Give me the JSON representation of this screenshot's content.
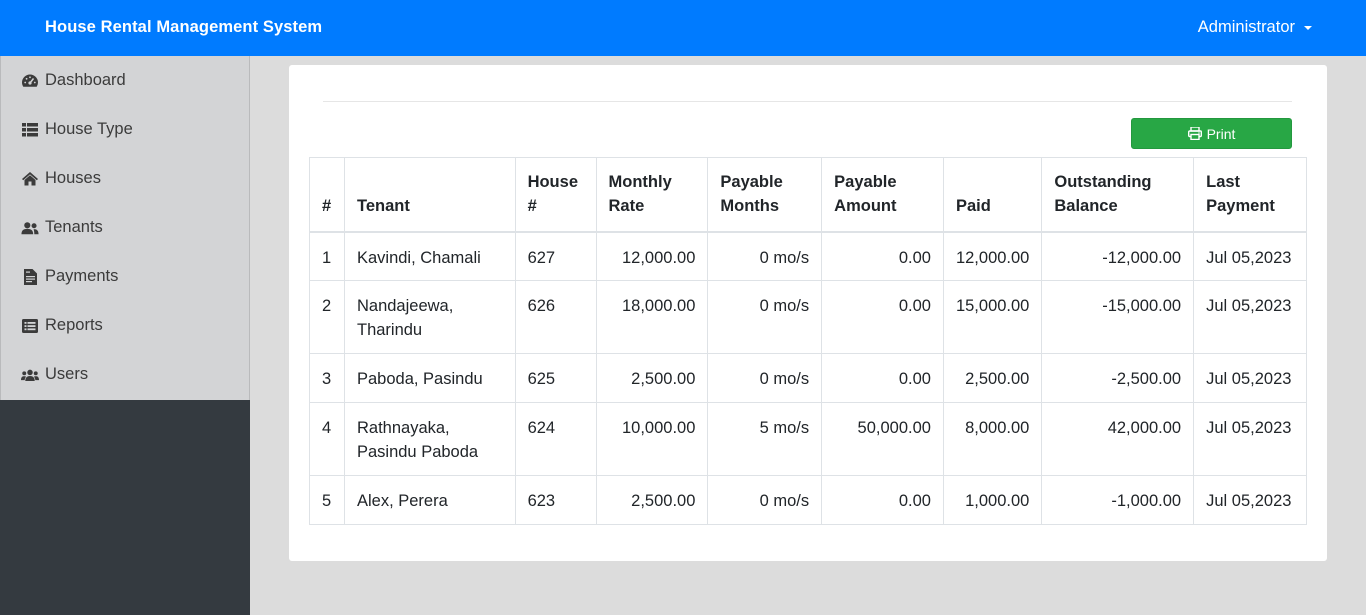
{
  "app": {
    "title": "House Rental Management System",
    "user": "Administrator"
  },
  "sidebar": {
    "items": [
      {
        "label": "Dashboard",
        "icon": "tachometer-icon"
      },
      {
        "label": "House Type",
        "icon": "list-icon"
      },
      {
        "label": "Houses",
        "icon": "home-icon"
      },
      {
        "label": "Tenants",
        "icon": "user-friends-icon"
      },
      {
        "label": "Payments",
        "icon": "file-invoice-icon"
      },
      {
        "label": "Reports",
        "icon": "list-alt-icon"
      },
      {
        "label": "Users",
        "icon": "users-icon"
      }
    ]
  },
  "report": {
    "print_label": "Print",
    "columns": [
      {
        "line1": "#",
        "line2": ""
      },
      {
        "line1": "Tenant",
        "line2": ""
      },
      {
        "line1": "House",
        "line2": "#"
      },
      {
        "line1": "Monthly",
        "line2": "Rate"
      },
      {
        "line1": "Payable",
        "line2": "Months"
      },
      {
        "line1": "Payable",
        "line2": "Amount"
      },
      {
        "line1": "Paid",
        "line2": ""
      },
      {
        "line1": "Outstanding",
        "line2": "Balance"
      },
      {
        "line1": "Last",
        "line2": "Payment"
      }
    ],
    "rows": [
      {
        "no": "1",
        "tenant": "Kavindi, Chamali",
        "house": "627",
        "monthly_rate": "12,000.00",
        "payable_months": "0 mo/s",
        "payable_amount": "0.00",
        "paid": "12,000.00",
        "balance": "-12,000.00",
        "last_payment": "Jul 05,2023"
      },
      {
        "no": "2",
        "tenant": "Nandajeewa, Tharindu",
        "house": "626",
        "monthly_rate": "18,000.00",
        "payable_months": "0 mo/s",
        "payable_amount": "0.00",
        "paid": "15,000.00",
        "balance": "-15,000.00",
        "last_payment": "Jul 05,2023"
      },
      {
        "no": "3",
        "tenant": "Paboda, Pasindu",
        "house": "625",
        "monthly_rate": "2,500.00",
        "payable_months": "0 mo/s",
        "payable_amount": "0.00",
        "paid": "2,500.00",
        "balance": "-2,500.00",
        "last_payment": "Jul 05,2023"
      },
      {
        "no": "4",
        "tenant": "Rathnayaka, Pasindu Paboda",
        "house": "624",
        "monthly_rate": "10,000.00",
        "payable_months": "5 mo/s",
        "payable_amount": "50,000.00",
        "paid": "8,000.00",
        "balance": "42,000.00",
        "last_payment": "Jul 05,2023"
      },
      {
        "no": "5",
        "tenant": "Alex, Perera",
        "house": "623",
        "monthly_rate": "2,500.00",
        "payable_months": "0 mo/s",
        "payable_amount": "0.00",
        "paid": "1,000.00",
        "balance": "-1,000.00",
        "last_payment": "Jul 05,2023"
      }
    ]
  }
}
